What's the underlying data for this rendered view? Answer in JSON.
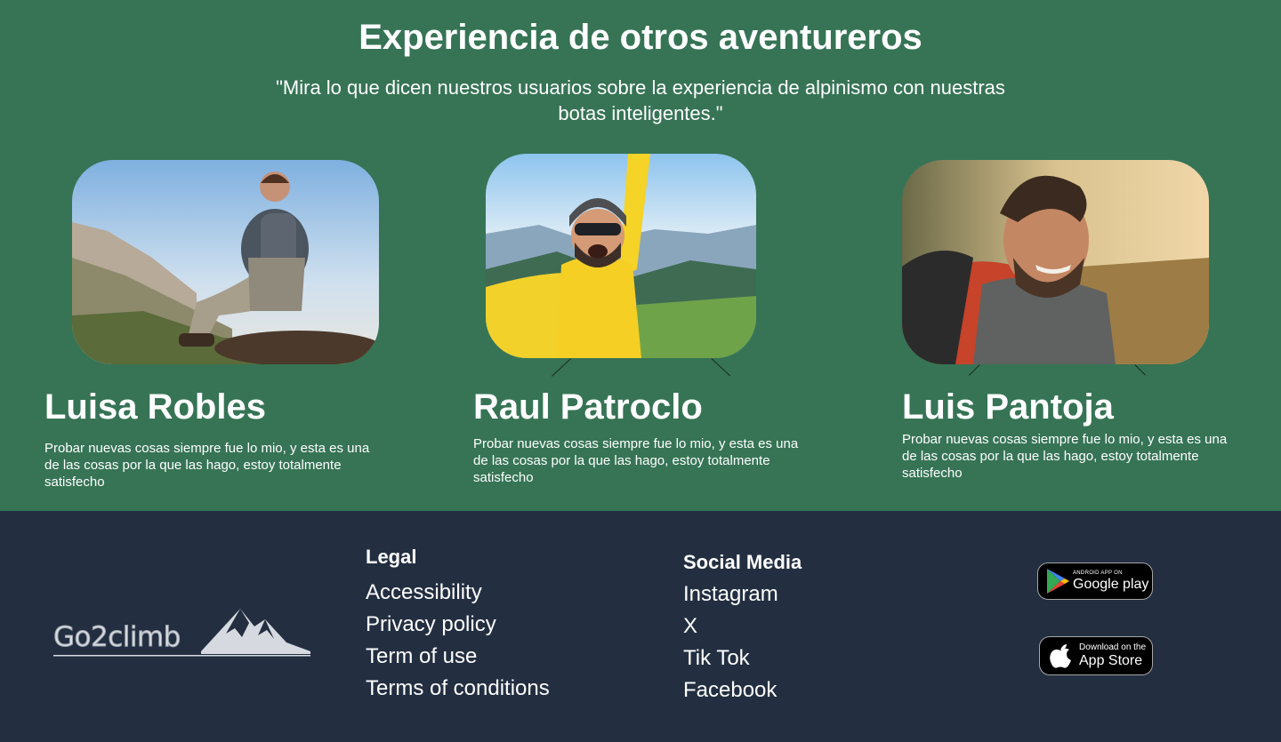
{
  "testimonials": {
    "title": "Experiencia de otros aventureros",
    "subtitle": "\"Mira lo que dicen nuestros usuarios sobre la experiencia de alpinismo con nuestras botas inteligentes.\"",
    "people": [
      {
        "name": "Luisa Robles",
        "quote": "Probar nuevas cosas siempre fue lo mio, y esta es una de las cosas por la que las hago, estoy totalmente satisfecho"
      },
      {
        "name": "Raul Patroclo",
        "quote": "Probar nuevas cosas siempre fue lo mio, y esta es una de las cosas por la que las hago, estoy totalmente satisfecho"
      },
      {
        "name": "Luis Pantoja",
        "quote": "Probar nuevas cosas siempre fue lo mio, y esta es una de las cosas por la que las hago, estoy totalmente satisfecho"
      }
    ]
  },
  "footer": {
    "logo_text": "Go2climb",
    "legal": {
      "title": "Legal",
      "links": [
        "Accessibility",
        "Privacy policy",
        "Term of use",
        "Terms of conditions"
      ]
    },
    "social": {
      "title": "Social Media",
      "links": [
        "Instagram",
        "X",
        "Tik Tok",
        "Facebook"
      ]
    },
    "google_play": {
      "small": "ANDROID APP ON",
      "big": "Google play"
    },
    "app_store": {
      "small": "Download on the",
      "big": "App Store"
    }
  },
  "colors": {
    "testimonial_bg": "#367455",
    "footer_bg": "#232f41"
  }
}
